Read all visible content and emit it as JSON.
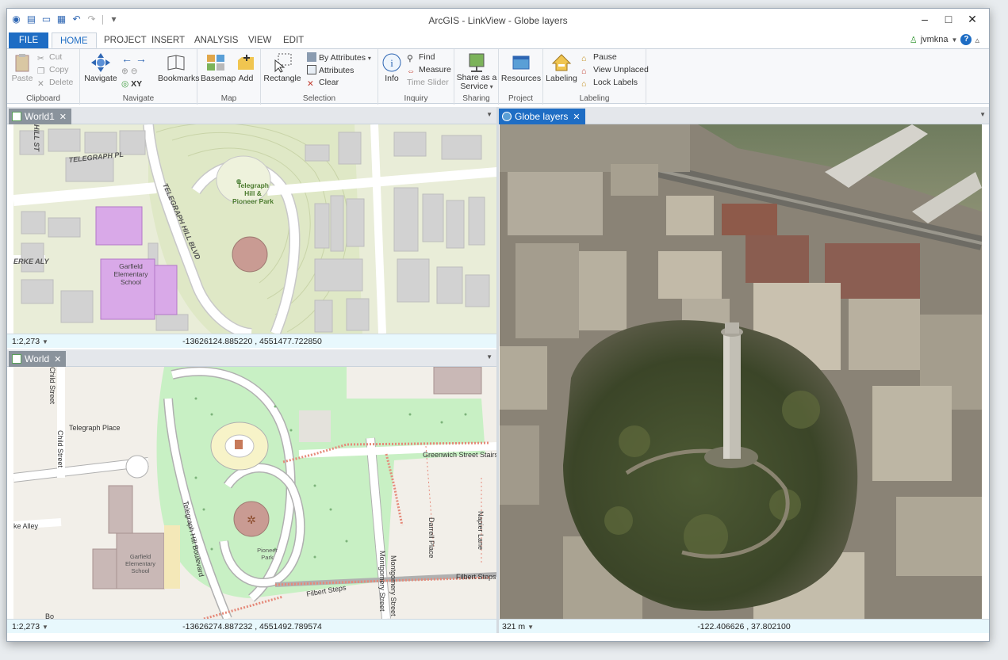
{
  "app": {
    "title": "ArcGIS - LinkView - Globe layers",
    "user": "jvmkna"
  },
  "ribbon_tabs": [
    "FILE",
    "HOME",
    "PROJECT",
    "INSERT",
    "ANALYSIS",
    "VIEW",
    "EDIT"
  ],
  "ribbon": {
    "clipboard": {
      "label": "Clipboard",
      "paste": "Paste",
      "cut": "Cut",
      "copy": "Copy",
      "delete": "Delete"
    },
    "navigate": {
      "label": "Navigate",
      "navigate": "Navigate",
      "bookmarks": "Bookmarks",
      "xy": "XY"
    },
    "map": {
      "label": "Map",
      "basemap": "Basemap",
      "add": "Add"
    },
    "selection": {
      "label": "Selection",
      "rectangle": "Rectangle",
      "by_attributes": "By Attributes",
      "attributes": "Attributes",
      "clear": "Clear"
    },
    "inquiry": {
      "label": "Inquiry",
      "info": "Info",
      "find": "Find",
      "measure": "Measure",
      "time_slider": "Time Slider"
    },
    "sharing": {
      "label": "Sharing",
      "share": "Share as a",
      "share2": "Service"
    },
    "project": {
      "label": "Project",
      "resources": "Resources"
    },
    "labeling": {
      "label": "Labeling",
      "labeling": "Labeling",
      "pause": "Pause",
      "view_unplaced": "View Unplaced",
      "lock_labels": "Lock Labels"
    }
  },
  "panes": {
    "world1": {
      "tab": "World1",
      "scale": "1:2,273",
      "coords": "-13626124.885220 , 4551477.722850",
      "labels": {
        "street1": "TELEGRAPH PL",
        "street2": "TELEGRAPH HILL BLVD",
        "street3": "ERKE ALY",
        "street4": "HILL ST",
        "park": "Telegraph",
        "park2": "Hill &",
        "park3": "Pioneer Park",
        "school1": "Garfield",
        "school2": "Elementary",
        "school3": "School"
      }
    },
    "world": {
      "tab": "World",
      "scale": "1:2,273",
      "coords": "-13626274.887232 , 4551492.789574",
      "labels": {
        "child1": "Child Street",
        "child2": "Child Street",
        "telegraph_place": "Telegraph Place",
        "ke_alley": "ke Alley",
        "tgh_blvd": "Telegraph Hill Boulevard",
        "greenwich": "Greenwich Street Stairs",
        "darrell": "Darrell Place",
        "napier": "Napier Lane",
        "montgomery1": "Montgomery Street",
        "montgomery2": "Montgomery Street",
        "filbert1": "Filbert Steps",
        "filbert2": "Filbert Steps",
        "pioneer1": "Pioneer",
        "pioneer2": "Park",
        "garfield1": "Garfield",
        "garfield2": "Elementary",
        "garfield3": "School",
        "bo": "Bo"
      }
    },
    "globe": {
      "tab": "Globe layers",
      "scale": "321 m",
      "coords": "-122.406626 , 37.802100"
    }
  }
}
